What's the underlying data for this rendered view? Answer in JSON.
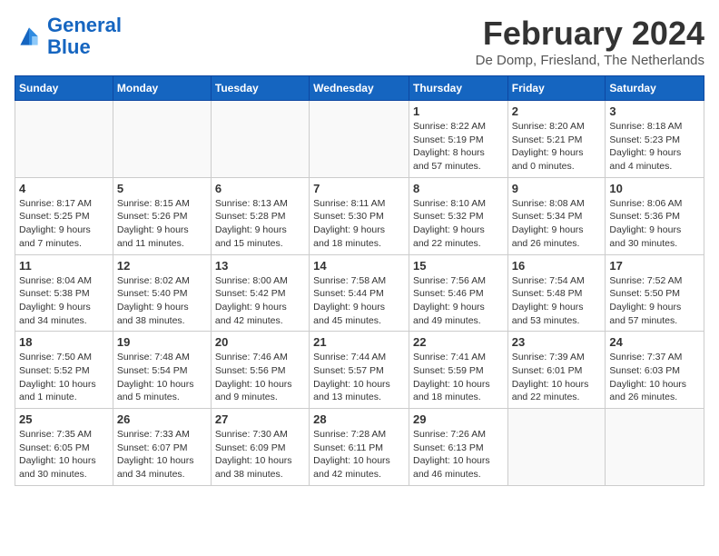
{
  "header": {
    "logo_line1": "General",
    "logo_line2": "Blue",
    "month": "February 2024",
    "location": "De Domp, Friesland, The Netherlands"
  },
  "weekdays": [
    "Sunday",
    "Monday",
    "Tuesday",
    "Wednesday",
    "Thursday",
    "Friday",
    "Saturday"
  ],
  "weeks": [
    [
      {
        "day": "",
        "info": ""
      },
      {
        "day": "",
        "info": ""
      },
      {
        "day": "",
        "info": ""
      },
      {
        "day": "",
        "info": ""
      },
      {
        "day": "1",
        "info": "Sunrise: 8:22 AM\nSunset: 5:19 PM\nDaylight: 8 hours\nand 57 minutes."
      },
      {
        "day": "2",
        "info": "Sunrise: 8:20 AM\nSunset: 5:21 PM\nDaylight: 9 hours\nand 0 minutes."
      },
      {
        "day": "3",
        "info": "Sunrise: 8:18 AM\nSunset: 5:23 PM\nDaylight: 9 hours\nand 4 minutes."
      }
    ],
    [
      {
        "day": "4",
        "info": "Sunrise: 8:17 AM\nSunset: 5:25 PM\nDaylight: 9 hours\nand 7 minutes."
      },
      {
        "day": "5",
        "info": "Sunrise: 8:15 AM\nSunset: 5:26 PM\nDaylight: 9 hours\nand 11 minutes."
      },
      {
        "day": "6",
        "info": "Sunrise: 8:13 AM\nSunset: 5:28 PM\nDaylight: 9 hours\nand 15 minutes."
      },
      {
        "day": "7",
        "info": "Sunrise: 8:11 AM\nSunset: 5:30 PM\nDaylight: 9 hours\nand 18 minutes."
      },
      {
        "day": "8",
        "info": "Sunrise: 8:10 AM\nSunset: 5:32 PM\nDaylight: 9 hours\nand 22 minutes."
      },
      {
        "day": "9",
        "info": "Sunrise: 8:08 AM\nSunset: 5:34 PM\nDaylight: 9 hours\nand 26 minutes."
      },
      {
        "day": "10",
        "info": "Sunrise: 8:06 AM\nSunset: 5:36 PM\nDaylight: 9 hours\nand 30 minutes."
      }
    ],
    [
      {
        "day": "11",
        "info": "Sunrise: 8:04 AM\nSunset: 5:38 PM\nDaylight: 9 hours\nand 34 minutes."
      },
      {
        "day": "12",
        "info": "Sunrise: 8:02 AM\nSunset: 5:40 PM\nDaylight: 9 hours\nand 38 minutes."
      },
      {
        "day": "13",
        "info": "Sunrise: 8:00 AM\nSunset: 5:42 PM\nDaylight: 9 hours\nand 42 minutes."
      },
      {
        "day": "14",
        "info": "Sunrise: 7:58 AM\nSunset: 5:44 PM\nDaylight: 9 hours\nand 45 minutes."
      },
      {
        "day": "15",
        "info": "Sunrise: 7:56 AM\nSunset: 5:46 PM\nDaylight: 9 hours\nand 49 minutes."
      },
      {
        "day": "16",
        "info": "Sunrise: 7:54 AM\nSunset: 5:48 PM\nDaylight: 9 hours\nand 53 minutes."
      },
      {
        "day": "17",
        "info": "Sunrise: 7:52 AM\nSunset: 5:50 PM\nDaylight: 9 hours\nand 57 minutes."
      }
    ],
    [
      {
        "day": "18",
        "info": "Sunrise: 7:50 AM\nSunset: 5:52 PM\nDaylight: 10 hours\nand 1 minute."
      },
      {
        "day": "19",
        "info": "Sunrise: 7:48 AM\nSunset: 5:54 PM\nDaylight: 10 hours\nand 5 minutes."
      },
      {
        "day": "20",
        "info": "Sunrise: 7:46 AM\nSunset: 5:56 PM\nDaylight: 10 hours\nand 9 minutes."
      },
      {
        "day": "21",
        "info": "Sunrise: 7:44 AM\nSunset: 5:57 PM\nDaylight: 10 hours\nand 13 minutes."
      },
      {
        "day": "22",
        "info": "Sunrise: 7:41 AM\nSunset: 5:59 PM\nDaylight: 10 hours\nand 18 minutes."
      },
      {
        "day": "23",
        "info": "Sunrise: 7:39 AM\nSunset: 6:01 PM\nDaylight: 10 hours\nand 22 minutes."
      },
      {
        "day": "24",
        "info": "Sunrise: 7:37 AM\nSunset: 6:03 PM\nDaylight: 10 hours\nand 26 minutes."
      }
    ],
    [
      {
        "day": "25",
        "info": "Sunrise: 7:35 AM\nSunset: 6:05 PM\nDaylight: 10 hours\nand 30 minutes."
      },
      {
        "day": "26",
        "info": "Sunrise: 7:33 AM\nSunset: 6:07 PM\nDaylight: 10 hours\nand 34 minutes."
      },
      {
        "day": "27",
        "info": "Sunrise: 7:30 AM\nSunset: 6:09 PM\nDaylight: 10 hours\nand 38 minutes."
      },
      {
        "day": "28",
        "info": "Sunrise: 7:28 AM\nSunset: 6:11 PM\nDaylight: 10 hours\nand 42 minutes."
      },
      {
        "day": "29",
        "info": "Sunrise: 7:26 AM\nSunset: 6:13 PM\nDaylight: 10 hours\nand 46 minutes."
      },
      {
        "day": "",
        "info": ""
      },
      {
        "day": "",
        "info": ""
      }
    ]
  ]
}
